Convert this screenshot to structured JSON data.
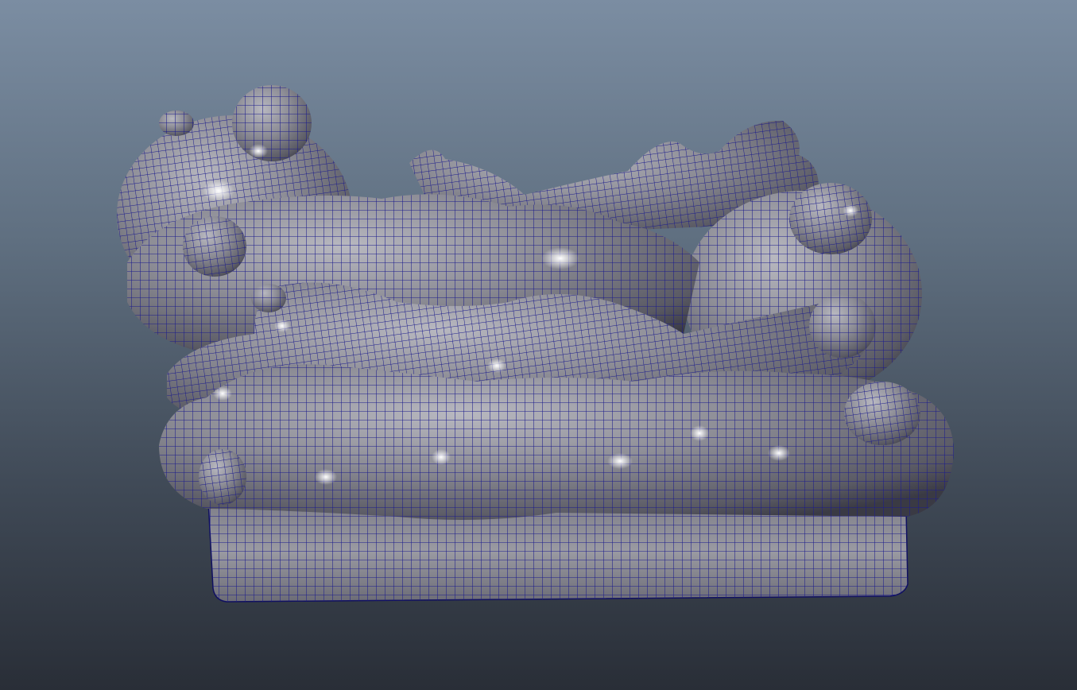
{
  "viewport": {
    "background_top": "#7b8da2",
    "background_bottom": "#292e37",
    "mesh_fill": "#8e8e96",
    "mesh_shadow": "#3c3c46",
    "highlight": "#ffffff",
    "wire_color": "#1c1c8c",
    "display_mode": "smooth-shaded-wireframe-on-shaded",
    "object": "subdivided-polygon-mesh"
  }
}
